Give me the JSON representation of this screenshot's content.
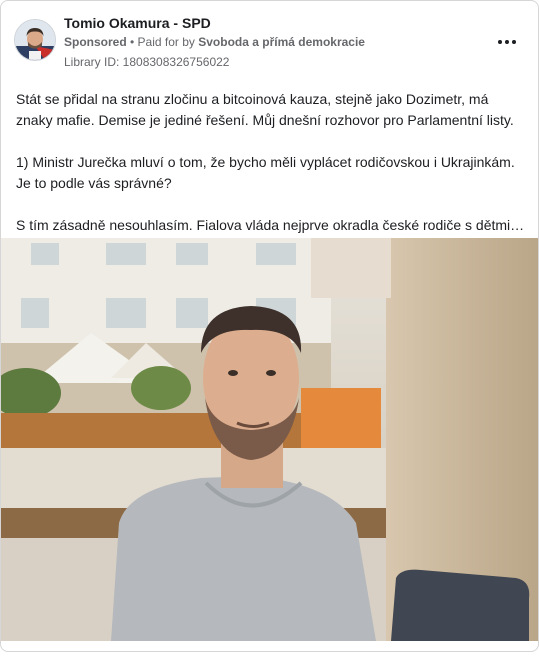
{
  "post": {
    "author": "Tomio Okamura - SPD",
    "sponsored": "Sponsored",
    "separator": " • ",
    "paid_for_prefix": "Paid for by ",
    "payer": "Svoboda a přímá demokracie",
    "library_id": "Library ID: 1808308326756022",
    "more_icon": "more-horizontal-icon",
    "paragraphs": [
      "Stát se přidal na stranu zločinu a bitcoinová kauza, stejně jako Dozimetr, má znaky mafie. Demise je jediné řešení. Můj dnešní rozhovor pro Parlamentní listy.",
      "1) Ministr Jurečka mluví o tom, že bycho měli vyplácet rodičovskou i Ukrajinkám. Je to podle vás správné?",
      "S tím zásadně nesouhlasím. Fialova vláda nejprve okradla české rodiče s dětmi o…"
    ]
  }
}
